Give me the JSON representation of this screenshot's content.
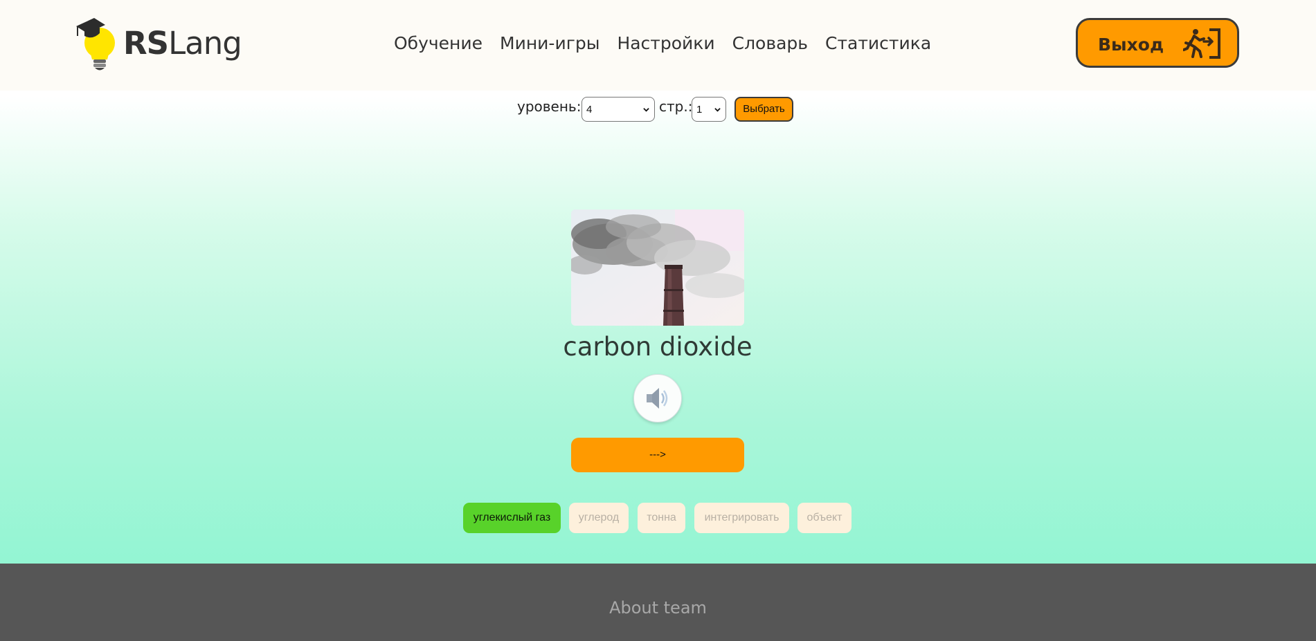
{
  "header": {
    "logo_text_bold": "RS",
    "logo_text_light": "Lang",
    "nav": [
      "Обучение",
      "Мини-игры",
      "Настройки",
      "Словарь",
      "Статистика"
    ],
    "exit_label": "Выход",
    "exit_icon": "exit-running-man-icon"
  },
  "level_bar": {
    "level_label": "уровень:",
    "level_value": "4",
    "page_label": "стр.:",
    "page_value": "1",
    "choose_label": "Выбрать"
  },
  "card": {
    "image_icon": "smokestack-photo",
    "word": "carbon dioxide",
    "audio_icon": "speaker-icon",
    "next_label": "--->"
  },
  "options": [
    {
      "label": "углекислый газ",
      "state": "correct"
    },
    {
      "label": "углерод",
      "state": "muted"
    },
    {
      "label": "тонна",
      "state": "muted"
    },
    {
      "label": "интегрировать",
      "state": "muted"
    },
    {
      "label": "объект",
      "state": "muted"
    }
  ],
  "footer": {
    "about_label": "About team"
  },
  "colors": {
    "accent": "#ff9a00",
    "correct": "#58d22a",
    "footer": "#565656"
  }
}
